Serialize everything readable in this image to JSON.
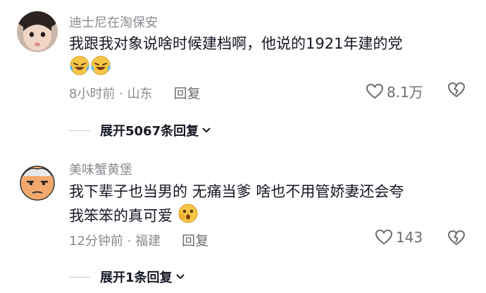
{
  "comments": [
    {
      "username": "迪士尼在淘保安",
      "text_line1": "我跟我对象说啥时候建档啊，他说的1921年建的党",
      "time_location": "8小时前 · 山东",
      "reply_label": "回复",
      "likes": "8.1万",
      "expand_label": "展开5067条回复",
      "emoji": "laughing-crying-emoji"
    },
    {
      "username": "美味蟹黄堡",
      "text_line1": "我下辈子也当男的 无痛当爹 啥也不用管娇妻还会夸",
      "text_line2": "我笨笨的真可爱",
      "time_location": "12分钟前 · 福建",
      "reply_label": "回复",
      "likes": "143",
      "expand_label": "展开1条回复",
      "emoji": "shocked-emoji"
    }
  ],
  "colors": {
    "primary_text": "#161823",
    "secondary_text": "#8a8b91",
    "divider": "#c9c9cc"
  }
}
